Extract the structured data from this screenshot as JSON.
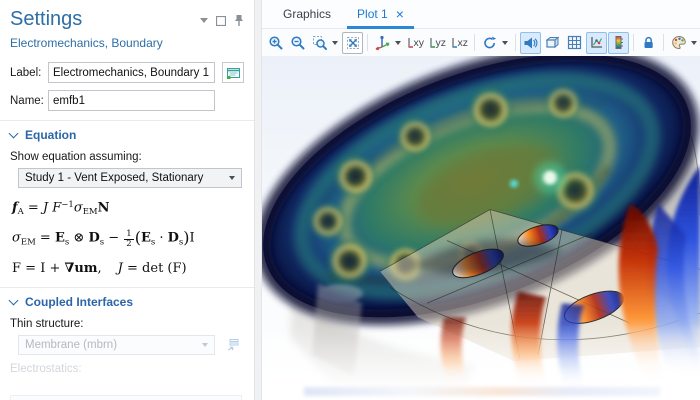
{
  "settings_panel": {
    "title": "Settings",
    "subtitle": "Electromechanics, Boundary",
    "header_icons": [
      "menu-chevron",
      "float-window",
      "pin"
    ],
    "label_field": {
      "label": "Label:",
      "value": "Electromechanics, Boundary 1"
    },
    "name_field": {
      "label": "Name:",
      "value": "emfb1"
    },
    "equation_section": {
      "title": "Equation",
      "show_equation_label": "Show equation assuming:",
      "study_dropdown_value": "Study 1 - Vent Exposed, Stationary",
      "equations": {
        "eq1": [
          {
            "t": "f",
            "s": "bi"
          },
          {
            "t": "A",
            "s": "sub"
          },
          {
            "t": " = ",
            "s": "r"
          },
          {
            "t": "J",
            "s": "i"
          },
          {
            "t": " F",
            "s": "i"
          },
          {
            "t": "−1",
            "s": "sup"
          },
          {
            "t": "σ",
            "s": "i"
          },
          {
            "t": "EM",
            "s": "sub"
          },
          {
            "t": "N",
            "s": "b"
          }
        ],
        "eq2": [
          {
            "t": "σ",
            "s": "i"
          },
          {
            "t": "EM",
            "s": "sub"
          },
          {
            "t": " = ",
            "s": "r"
          },
          {
            "t": "E",
            "s": "b"
          },
          {
            "t": "s",
            "s": "sub"
          },
          {
            "t": " ⊗ ",
            "s": "r"
          },
          {
            "t": "D",
            "s": "b"
          },
          {
            "t": "s",
            "s": "sub"
          },
          {
            "t": " − ",
            "s": "r"
          },
          {
            "t": "1/2",
            "s": "frac"
          },
          {
            "t": "(",
            "s": "big"
          },
          {
            "t": "E",
            "s": "b"
          },
          {
            "t": "s",
            "s": "sub"
          },
          {
            "t": " · ",
            "s": "r"
          },
          {
            "t": "D",
            "s": "b"
          },
          {
            "t": "s",
            "s": "sub"
          },
          {
            "t": ")",
            "s": "big"
          },
          {
            "t": "I",
            "s": "r"
          }
        ],
        "eq3": [
          {
            "t": "F",
            "s": "r"
          },
          {
            "t": " = ",
            "s": "r"
          },
          {
            "t": "I",
            "s": "r"
          },
          {
            "t": " + ",
            "s": "r"
          },
          {
            "t": "∇",
            "s": "b"
          },
          {
            "t": "um",
            "s": "b"
          },
          {
            "t": ",",
            "s": "r"
          },
          {
            "t": "",
            "s": "gap"
          },
          {
            "t": "J",
            "s": "i"
          },
          {
            "t": " = det (",
            "s": "r"
          },
          {
            "t": "F",
            "s": "r"
          },
          {
            "t": ")",
            "s": "r"
          }
        ]
      }
    },
    "coupled_interfaces_section": {
      "title": "Coupled Interfaces",
      "thin_structure_label": "Thin structure:",
      "thin_structure_value": "Membrane (mbrn)",
      "electrostatics_label": "Electrostatics:"
    }
  },
  "graphics_panel": {
    "tabs": [
      {
        "label": "Graphics",
        "active": false
      },
      {
        "label": "Plot 1",
        "active": true,
        "close_icon": "×"
      }
    ],
    "toolbar": {
      "view_xy": "xy",
      "view_yz": "yz",
      "view_xz": "xz",
      "icon_names": [
        "zoom-in",
        "zoom-out",
        "zoom-box",
        "zoom-extents",
        "go-to-default-3d-view",
        "view-xy",
        "view-yz",
        "view-xz",
        "reset-view",
        "sound",
        "transparency",
        "grid",
        "show-plot-axes",
        "show-color-legend",
        "lock-view",
        "color-theme"
      ]
    }
  },
  "colors": {
    "title_blue": "#2d6da8",
    "section_header_blue": "#2b66a9",
    "active_tab_blue": "#1e7ad2",
    "toolbar_icon_blue": "#2e7bc4",
    "pressed_button_bg": "#d9eafc"
  }
}
